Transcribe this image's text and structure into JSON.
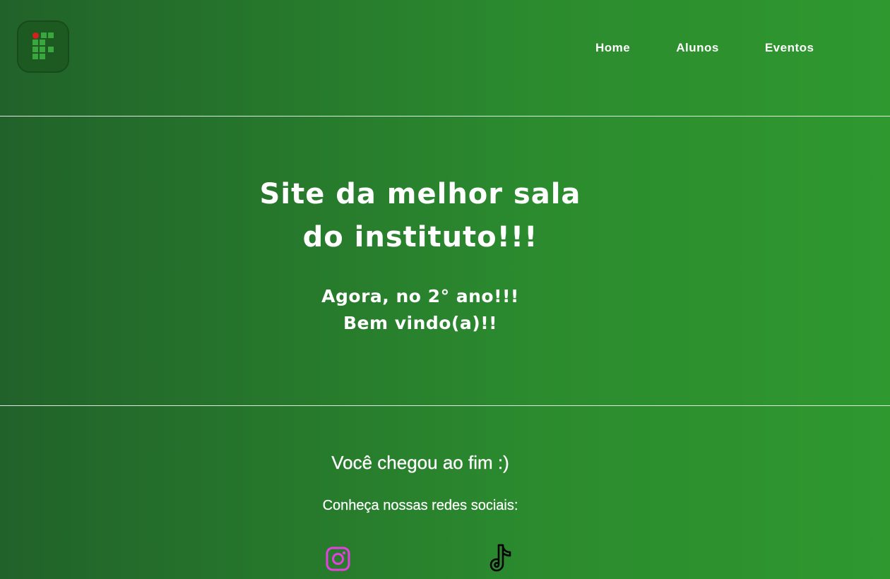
{
  "header": {
    "logo_name": "institute-logo",
    "nav": [
      {
        "label": "Home"
      },
      {
        "label": "Alunos"
      },
      {
        "label": "Eventos"
      }
    ]
  },
  "hero": {
    "title_line1": "Site da melhor sala",
    "title_line2": "do instituto!!!",
    "subtitle_line1": "Agora, no 2° ano!!!",
    "subtitle_line2": "Bem vindo(a)!!"
  },
  "footer": {
    "title": "Você chegou ao fim :)",
    "subtitle": "Conheça nossas redes sociais:",
    "social": [
      {
        "icon": "instagram-icon",
        "color": "#e73fe3"
      },
      {
        "icon": "tiktok-icon",
        "color": "#000000"
      }
    ]
  },
  "colors": {
    "background_left": "#21622a",
    "background_right": "#2f982f",
    "text": "#ffffff",
    "logo_square": "#3aa63e",
    "logo_dot": "#d61f1f"
  }
}
